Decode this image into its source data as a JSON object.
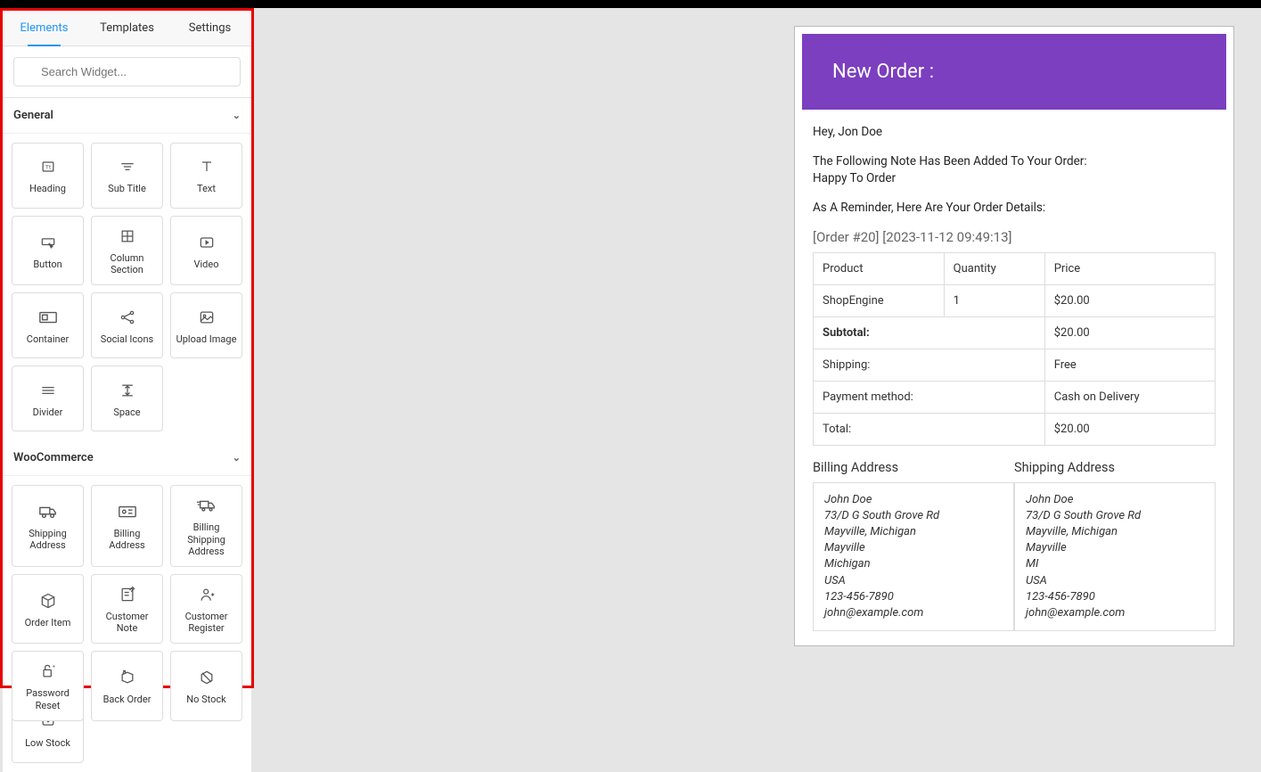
{
  "tabs": {
    "elements": "Elements",
    "templates": "Templates",
    "settings": "Settings"
  },
  "search": {
    "placeholder": "Search Widget..."
  },
  "sections": {
    "general": "General",
    "woocommerce": "WooCommerce"
  },
  "widgets": {
    "general": [
      "Heading",
      "Sub Title",
      "Text",
      "Button",
      "Column Section",
      "Video",
      "Container",
      "Social Icons",
      "Upload Image",
      "Divider",
      "Space"
    ],
    "woocommerce": [
      "Shipping Address",
      "Billing Address",
      "Billing Shipping Address",
      "Order Item",
      "Customer Note",
      "Customer Register",
      "Password Reset",
      "Back Order",
      "No Stock"
    ],
    "extra": [
      "Low Stock"
    ]
  },
  "email": {
    "title": "New Order :",
    "greeting": "Hey, Jon Doe",
    "note_intro": "The Following Note Has Been Added To Your Order:",
    "note_body": "Happy To Order",
    "reminder": "As A Reminder, Here Are Your Order Details:",
    "meta": "[Order #20] [2023-11-12 09:49:13]",
    "table": {
      "h_product": "Product",
      "h_qty": "Quantity",
      "h_price": "Price",
      "product": "ShopEngine",
      "qty": "1",
      "price": "$20.00",
      "subtotal_label": "Subtotal:",
      "subtotal": "$20.00",
      "shipping_label": "Shipping:",
      "shipping": "Free",
      "payment_label": "Payment method:",
      "payment": "Cash on Delivery",
      "total_label": "Total:",
      "total": "$20.00"
    },
    "billing": {
      "title": "Billing Address",
      "name": "John Doe",
      "street": "73/D G South Grove Rd",
      "city_state": "Mayville, Michigan",
      "city": "Mayville",
      "state": "Michigan",
      "country": "USA",
      "phone": "123-456-7890",
      "mail": "john@example.com"
    },
    "shipping": {
      "title": "Shipping Address",
      "name": "John Doe",
      "street": "73/D G South Grove Rd",
      "city_state": "Mayville, Michigan",
      "city": "Mayville",
      "state": "MI",
      "country": "USA",
      "phone": "123-456-7890",
      "mail": "john@example.com"
    }
  }
}
